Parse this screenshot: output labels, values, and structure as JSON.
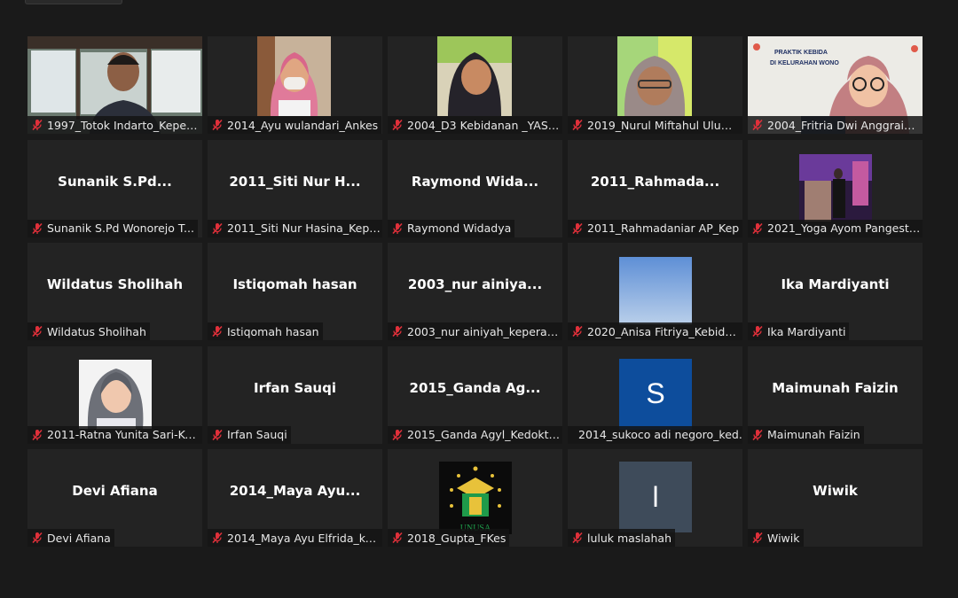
{
  "tiles": [
    {
      "center": "",
      "label": "1997_Totok Indarto_Kepera...",
      "muted": true,
      "kind": "video-office"
    },
    {
      "center": "",
      "label": "2014_Ayu wulandari_Ankes",
      "muted": true,
      "kind": "video-hijab-pink"
    },
    {
      "center": "",
      "label": "2004_D3 Kebidanan _YASI ...",
      "muted": true,
      "kind": "video-hijab-dark"
    },
    {
      "center": "",
      "label": "2019_Nurul Miftahul Ulumi...",
      "muted": true,
      "kind": "video-hijab-grey"
    },
    {
      "center": "",
      "label": "2004_Fritria Dwi Anggraini_...",
      "muted": true,
      "kind": "video-poster",
      "poster_text": [
        "PRAKTIK KEBIDA",
        "DI KELURAHAN WONO"
      ]
    },
    {
      "center": "Sunanik  S.Pd...",
      "label": "Sunanik S.Pd   Wonorejo T...",
      "muted": true,
      "kind": "name"
    },
    {
      "center": "2011_Siti Nur H...",
      "label": "2011_Siti Nur Hasina_Kepe...",
      "muted": true,
      "kind": "name"
    },
    {
      "center": "Raymond  Wida...",
      "label": "Raymond Widadya",
      "muted": true,
      "kind": "name"
    },
    {
      "center": "2011_Rahmada...",
      "label": "2011_Rahmadaniar AP_Kep",
      "muted": true,
      "kind": "name"
    },
    {
      "center": "",
      "label": "2021_Yoga Ayom Pangestu...",
      "muted": true,
      "kind": "photo-purple"
    },
    {
      "center": "Wildatus Sholihah",
      "label": "Wildatus Sholihah",
      "muted": true,
      "kind": "name"
    },
    {
      "center": "Istiqomah hasan",
      "label": "Istiqomah hasan",
      "muted": true,
      "kind": "name"
    },
    {
      "center": "2003_nur  ainiya...",
      "label": "2003_nur ainiyah_keperawa...",
      "muted": true,
      "kind": "name"
    },
    {
      "center": "",
      "label": "2020_Anisa Fitriya_Kebidan...",
      "muted": true,
      "kind": "photo-sky"
    },
    {
      "center": "Ika Mardiyanti",
      "label": "Ika Mardiyanti",
      "muted": true,
      "kind": "name"
    },
    {
      "center": "",
      "label": "2011-Ratna Yunita Sari-Ke...",
      "muted": true,
      "kind": "photo-hijab"
    },
    {
      "center": "Irfan Sauqi",
      "label": "Irfan Sauqi",
      "muted": true,
      "kind": "name"
    },
    {
      "center": "2015_Ganda  Ag...",
      "label": "2015_Ganda Agyl_Kedokter...",
      "muted": true,
      "kind": "name"
    },
    {
      "center": "",
      "label": "2014_sukoco adi negoro_ked...",
      "muted": false,
      "kind": "avatar",
      "avatar_letter": "S",
      "avatar_color": "#0d4d9c"
    },
    {
      "center": "Maimunah Faizin",
      "label": "Maimunah Faizin",
      "muted": true,
      "kind": "name"
    },
    {
      "center": "Devi Afiana",
      "label": "Devi Afiana",
      "muted": true,
      "kind": "name"
    },
    {
      "center": "2014_Maya  Ayu...",
      "label": "2014_Maya Ayu Elfrida_ked...",
      "muted": true,
      "kind": "name"
    },
    {
      "center": "",
      "label": "2018_Gupta_FKes",
      "muted": true,
      "kind": "logo",
      "logo_text": "UNUSA"
    },
    {
      "center": "",
      "label": "luluk maslahah",
      "muted": true,
      "kind": "avatar",
      "avatar_letter": "l",
      "avatar_color": "#3e4b5a"
    },
    {
      "center": "Wiwik",
      "label": "Wiwik",
      "muted": true,
      "kind": "name"
    }
  ],
  "colors": {
    "background": "#1a1a1a",
    "tile": "#232323",
    "muted_red": "#e0303a"
  }
}
